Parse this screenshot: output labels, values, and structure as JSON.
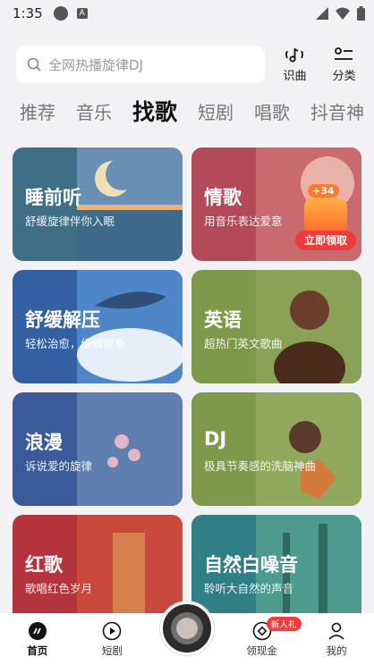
{
  "status_bar": {
    "time": "1:35"
  },
  "search": {
    "placeholder": "全网热播旋律DJ"
  },
  "toolbar": {
    "identify_label": "识曲",
    "category_label": "分类"
  },
  "tabs": [
    {
      "label": "推荐",
      "active": false
    },
    {
      "label": "音乐",
      "active": false
    },
    {
      "label": "找歌",
      "active": true
    },
    {
      "label": "短剧",
      "active": false
    },
    {
      "label": "唱歌",
      "active": false
    },
    {
      "label": "抖音神",
      "active": false
    }
  ],
  "cards": [
    {
      "title": "睡前听",
      "subtitle": "舒缓旋律伴你入眠",
      "color": "#3f6f86"
    },
    {
      "title": "情歌",
      "subtitle": "用音乐表达爱意",
      "color": "#b24a59"
    },
    {
      "title": "舒缓解压",
      "subtitle": "轻松治愈，缓解疲惫",
      "color": "#335fa3"
    },
    {
      "title": "英语",
      "subtitle": "超热门英文歌曲",
      "color": "#7c9a4a"
    },
    {
      "title": "浪漫",
      "subtitle": "诉说爱的旋律",
      "color": "#3a5a9a"
    },
    {
      "title": "DJ",
      "subtitle": "极具节奏感的洗脑神曲",
      "color": "#7c9a4a"
    },
    {
      "title": "红歌",
      "subtitle": "歌唱红色岁月",
      "color": "#b4343c"
    },
    {
      "title": "自然白噪音",
      "subtitle": "聆听大自然的声音",
      "color": "#317f86"
    }
  ],
  "promo": {
    "badge": "+34",
    "button_label": "立即领取"
  },
  "bottom_nav": [
    {
      "label": "首页",
      "active": true
    },
    {
      "label": "短剧",
      "active": false
    },
    {
      "label": "领现金",
      "active": false
    },
    {
      "label": "我的",
      "active": false
    }
  ],
  "new_badge": "新人礼"
}
